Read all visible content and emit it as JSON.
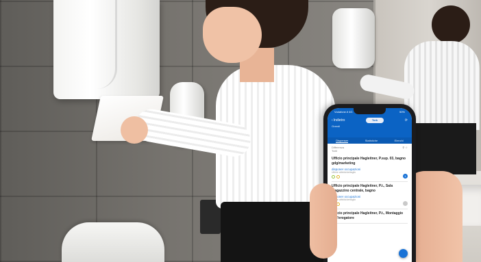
{
  "phone": {
    "status_left": "Vodafone.it 4G",
    "status_right": "50%",
    "back_label": "Indietro",
    "logo_text": "Tork",
    "subtitle": "Grandi",
    "tabs": [
      "Dispenser",
      "Statistiche",
      "Elenchi"
    ],
    "filter_left": "Differenza",
    "filter_sub": "Tutti",
    "items": [
      {
        "title": "Ufficio principale Hagleitner, P.sup. 03, bagno gdg/marketing",
        "status": "disponer occupazioni",
        "sub": "Ultime attività/dettaglio",
        "badge": "1"
      },
      {
        "title": "Ufficio principale Hagleitner, P.t., Sala magazzino centrale, bagno",
        "status": "disponer occupazioni",
        "sub": "Ultime attività/dettaglio",
        "badge": ""
      },
      {
        "title": "Ufficio principale Hagleitner, P.t., Montaggio dell'erogatore",
        "status": "",
        "sub": "",
        "badge": ""
      }
    ]
  },
  "colors": {
    "app_blue": "#0b63c4",
    "accent_blue": "#1a73d6",
    "dot_green": "#9ac33c",
    "dot_yellow": "#e2b52b"
  }
}
